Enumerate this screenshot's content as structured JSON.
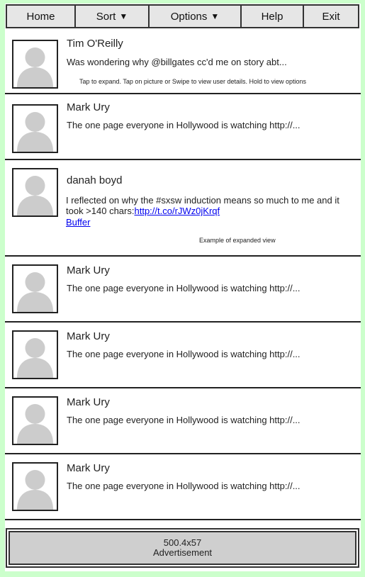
{
  "menu": {
    "home": "Home",
    "sort": "Sort",
    "options": "Options",
    "help": "Help",
    "exit": "Exit",
    "caret": "▼"
  },
  "tweets": [
    {
      "name": "Tim O'Reilly",
      "text": "Was wondering why @billgates cc'd me on story abt...",
      "hint": "Tap to expand. Tap on picture or Swipe to view user details. Hold to view options"
    },
    {
      "name": "Mark Ury",
      "text": "The one page everyone in Hollywood is watching http://..."
    },
    {
      "name": "danah boyd",
      "text": "I reflected on why the #sxsw induction means so much to me and it took >140 chars:",
      "link": "http://t.co/rJWz0jKrqf",
      "link2": "Buffer",
      "hint": "Example of expanded view"
    },
    {
      "name": "Mark Ury",
      "text": "The one page everyone in Hollywood is watching http://..."
    },
    {
      "name": "Mark Ury",
      "text": "The one page everyone in Hollywood is watching http://..."
    },
    {
      "name": "Mark Ury",
      "text": "The one page everyone in Hollywood is watching http://..."
    },
    {
      "name": "Mark Ury",
      "text": "The one page everyone in Hollywood is watching http://..."
    }
  ],
  "ad": {
    "size": "500.4x57",
    "label": "Advertisement"
  },
  "colors": {
    "background": "#ccffcc",
    "menu_bg": "#e6e6e6",
    "ad_bg": "#cfcfcf",
    "link": "#0000ee",
    "avatar_silhouette": "#cccccc"
  },
  "icons": {
    "avatar": "user-silhouette-icon",
    "dropdown": "caret-down-icon"
  }
}
